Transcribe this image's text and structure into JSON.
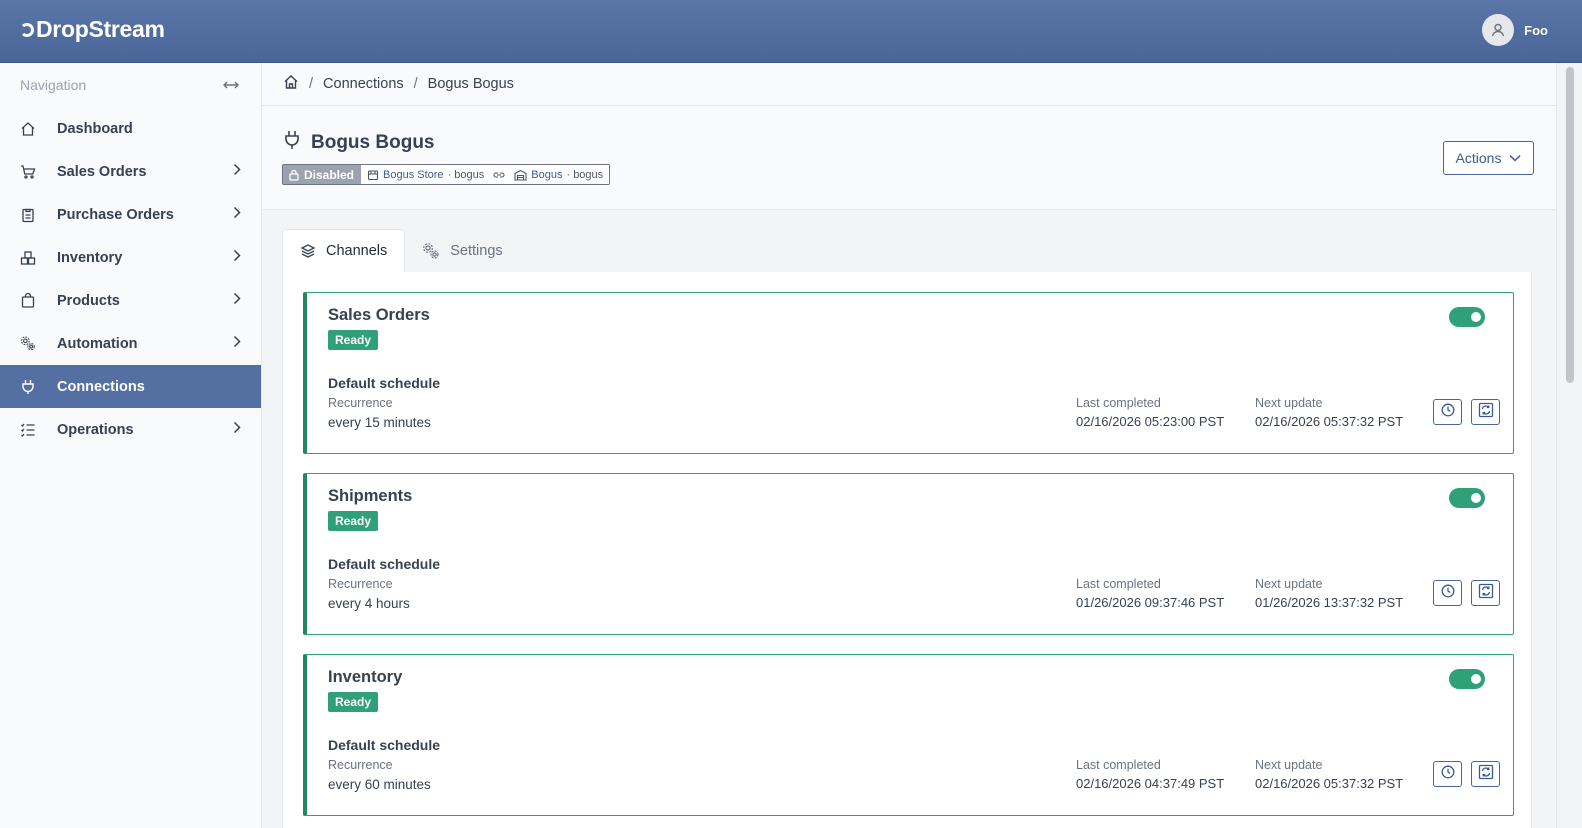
{
  "app": {
    "logo_text": "DropStream",
    "user_name": "Foo"
  },
  "sidebar": {
    "heading": "Navigation",
    "items": [
      {
        "label": "Dashboard",
        "icon": "home-icon",
        "has_children": false,
        "active": false
      },
      {
        "label": "Sales Orders",
        "icon": "cart-icon",
        "has_children": true,
        "active": false
      },
      {
        "label": "Purchase Orders",
        "icon": "clipboard-icon",
        "has_children": true,
        "active": false
      },
      {
        "label": "Inventory",
        "icon": "boxes-icon",
        "has_children": true,
        "active": false
      },
      {
        "label": "Products",
        "icon": "bag-icon",
        "has_children": true,
        "active": false
      },
      {
        "label": "Automation",
        "icon": "gears-icon",
        "has_children": true,
        "active": false
      },
      {
        "label": "Connections",
        "icon": "plug-icon",
        "has_children": false,
        "active": true
      },
      {
        "label": "Operations",
        "icon": "list-check-icon",
        "has_children": true,
        "active": false
      }
    ]
  },
  "breadcrumb": {
    "items": [
      "Connections",
      "Bogus Bogus"
    ]
  },
  "header": {
    "title": "Bogus Bogus",
    "status": "Disabled",
    "store_name": "Bogus Store",
    "store_id": "· bogus",
    "warehouse_name": "Bogus",
    "warehouse_id": "· bogus",
    "actions_label": "Actions"
  },
  "tabs": [
    {
      "label": "Channels",
      "active": true
    },
    {
      "label": "Settings",
      "active": false
    }
  ],
  "channels": [
    {
      "title": "Sales Orders",
      "status": "Ready",
      "enabled": true,
      "schedule_title": "Default schedule",
      "recurrence_label": "Recurrence",
      "recurrence": "every 15 minutes",
      "last_completed_label": "Last completed",
      "last_completed": "02/16/2026 05:23:00 PST",
      "next_update_label": "Next update",
      "next_update": "02/16/2026 05:37:32 PST"
    },
    {
      "title": "Shipments",
      "status": "Ready",
      "enabled": true,
      "schedule_title": "Default schedule",
      "recurrence_label": "Recurrence",
      "recurrence": "every 4 hours",
      "last_completed_label": "Last completed",
      "last_completed": "01/26/2026 09:37:46 PST",
      "next_update_label": "Next update",
      "next_update": "01/26/2026 13:37:32 PST"
    },
    {
      "title": "Inventory",
      "status": "Ready",
      "enabled": true,
      "schedule_title": "Default schedule",
      "recurrence_label": "Recurrence",
      "recurrence": "every 60 minutes",
      "last_completed_label": "Last completed",
      "last_completed": "02/16/2026 04:37:49 PST",
      "next_update_label": "Next update",
      "next_update": "02/16/2026 05:37:32 PST"
    }
  ],
  "colors": {
    "brand": "#4a6598",
    "ready": "#2fa078",
    "active_nav": "#5470a3"
  }
}
